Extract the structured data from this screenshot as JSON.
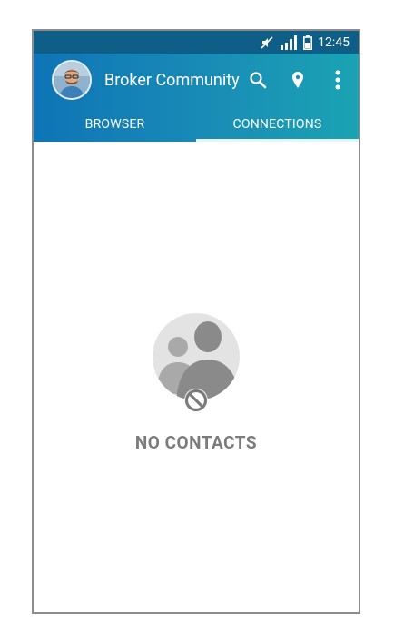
{
  "status_bar": {
    "time": "12:45",
    "icons": [
      "mute-icon",
      "signal-icon",
      "battery-icon"
    ]
  },
  "app_bar": {
    "title": "Broker Community",
    "actions": [
      "search-icon",
      "location-pin-icon",
      "overflow-menu-icon"
    ]
  },
  "tabs": [
    {
      "label": "BROWSER",
      "active": false
    },
    {
      "label": "CONNECTIONS",
      "active": true
    }
  ],
  "empty_state": {
    "label": "NO CONTACTS",
    "icon": "no-contacts-icon"
  },
  "colors": {
    "status_bar": "#0f5e87",
    "app_bar_start": "#0e74b6",
    "app_bar_end": "#1aa3b3",
    "empty_text": "#7b7b7b"
  }
}
